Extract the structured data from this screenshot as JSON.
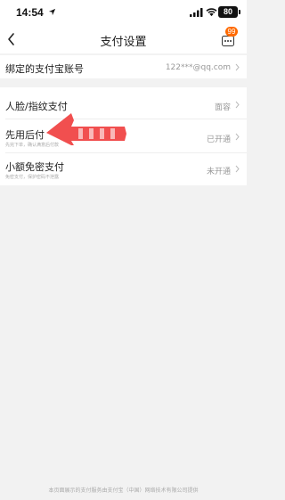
{
  "status_bar": {
    "time": "14:54",
    "battery": "80"
  },
  "nav": {
    "title": "支付设置",
    "badge": "99"
  },
  "account_row": {
    "label": "绑定的支付宝账号",
    "value": "122***@qq.com"
  },
  "settings": [
    {
      "label": "人脸/指纹支付",
      "sub": "",
      "value": "面容"
    },
    {
      "label": "先用后付",
      "sub": "先完下单，确认满意后付款",
      "value": "已开通"
    },
    {
      "label": "小额免密支付",
      "sub": "免密支付，保护密码不泄露",
      "value": "未开通"
    }
  ],
  "footer": "本页面展示的支付服务由支付宝（中国）网络技术有限公司提供",
  "colors": {
    "accent": "#ff6a00",
    "annotation_arrow": "#f04040"
  }
}
